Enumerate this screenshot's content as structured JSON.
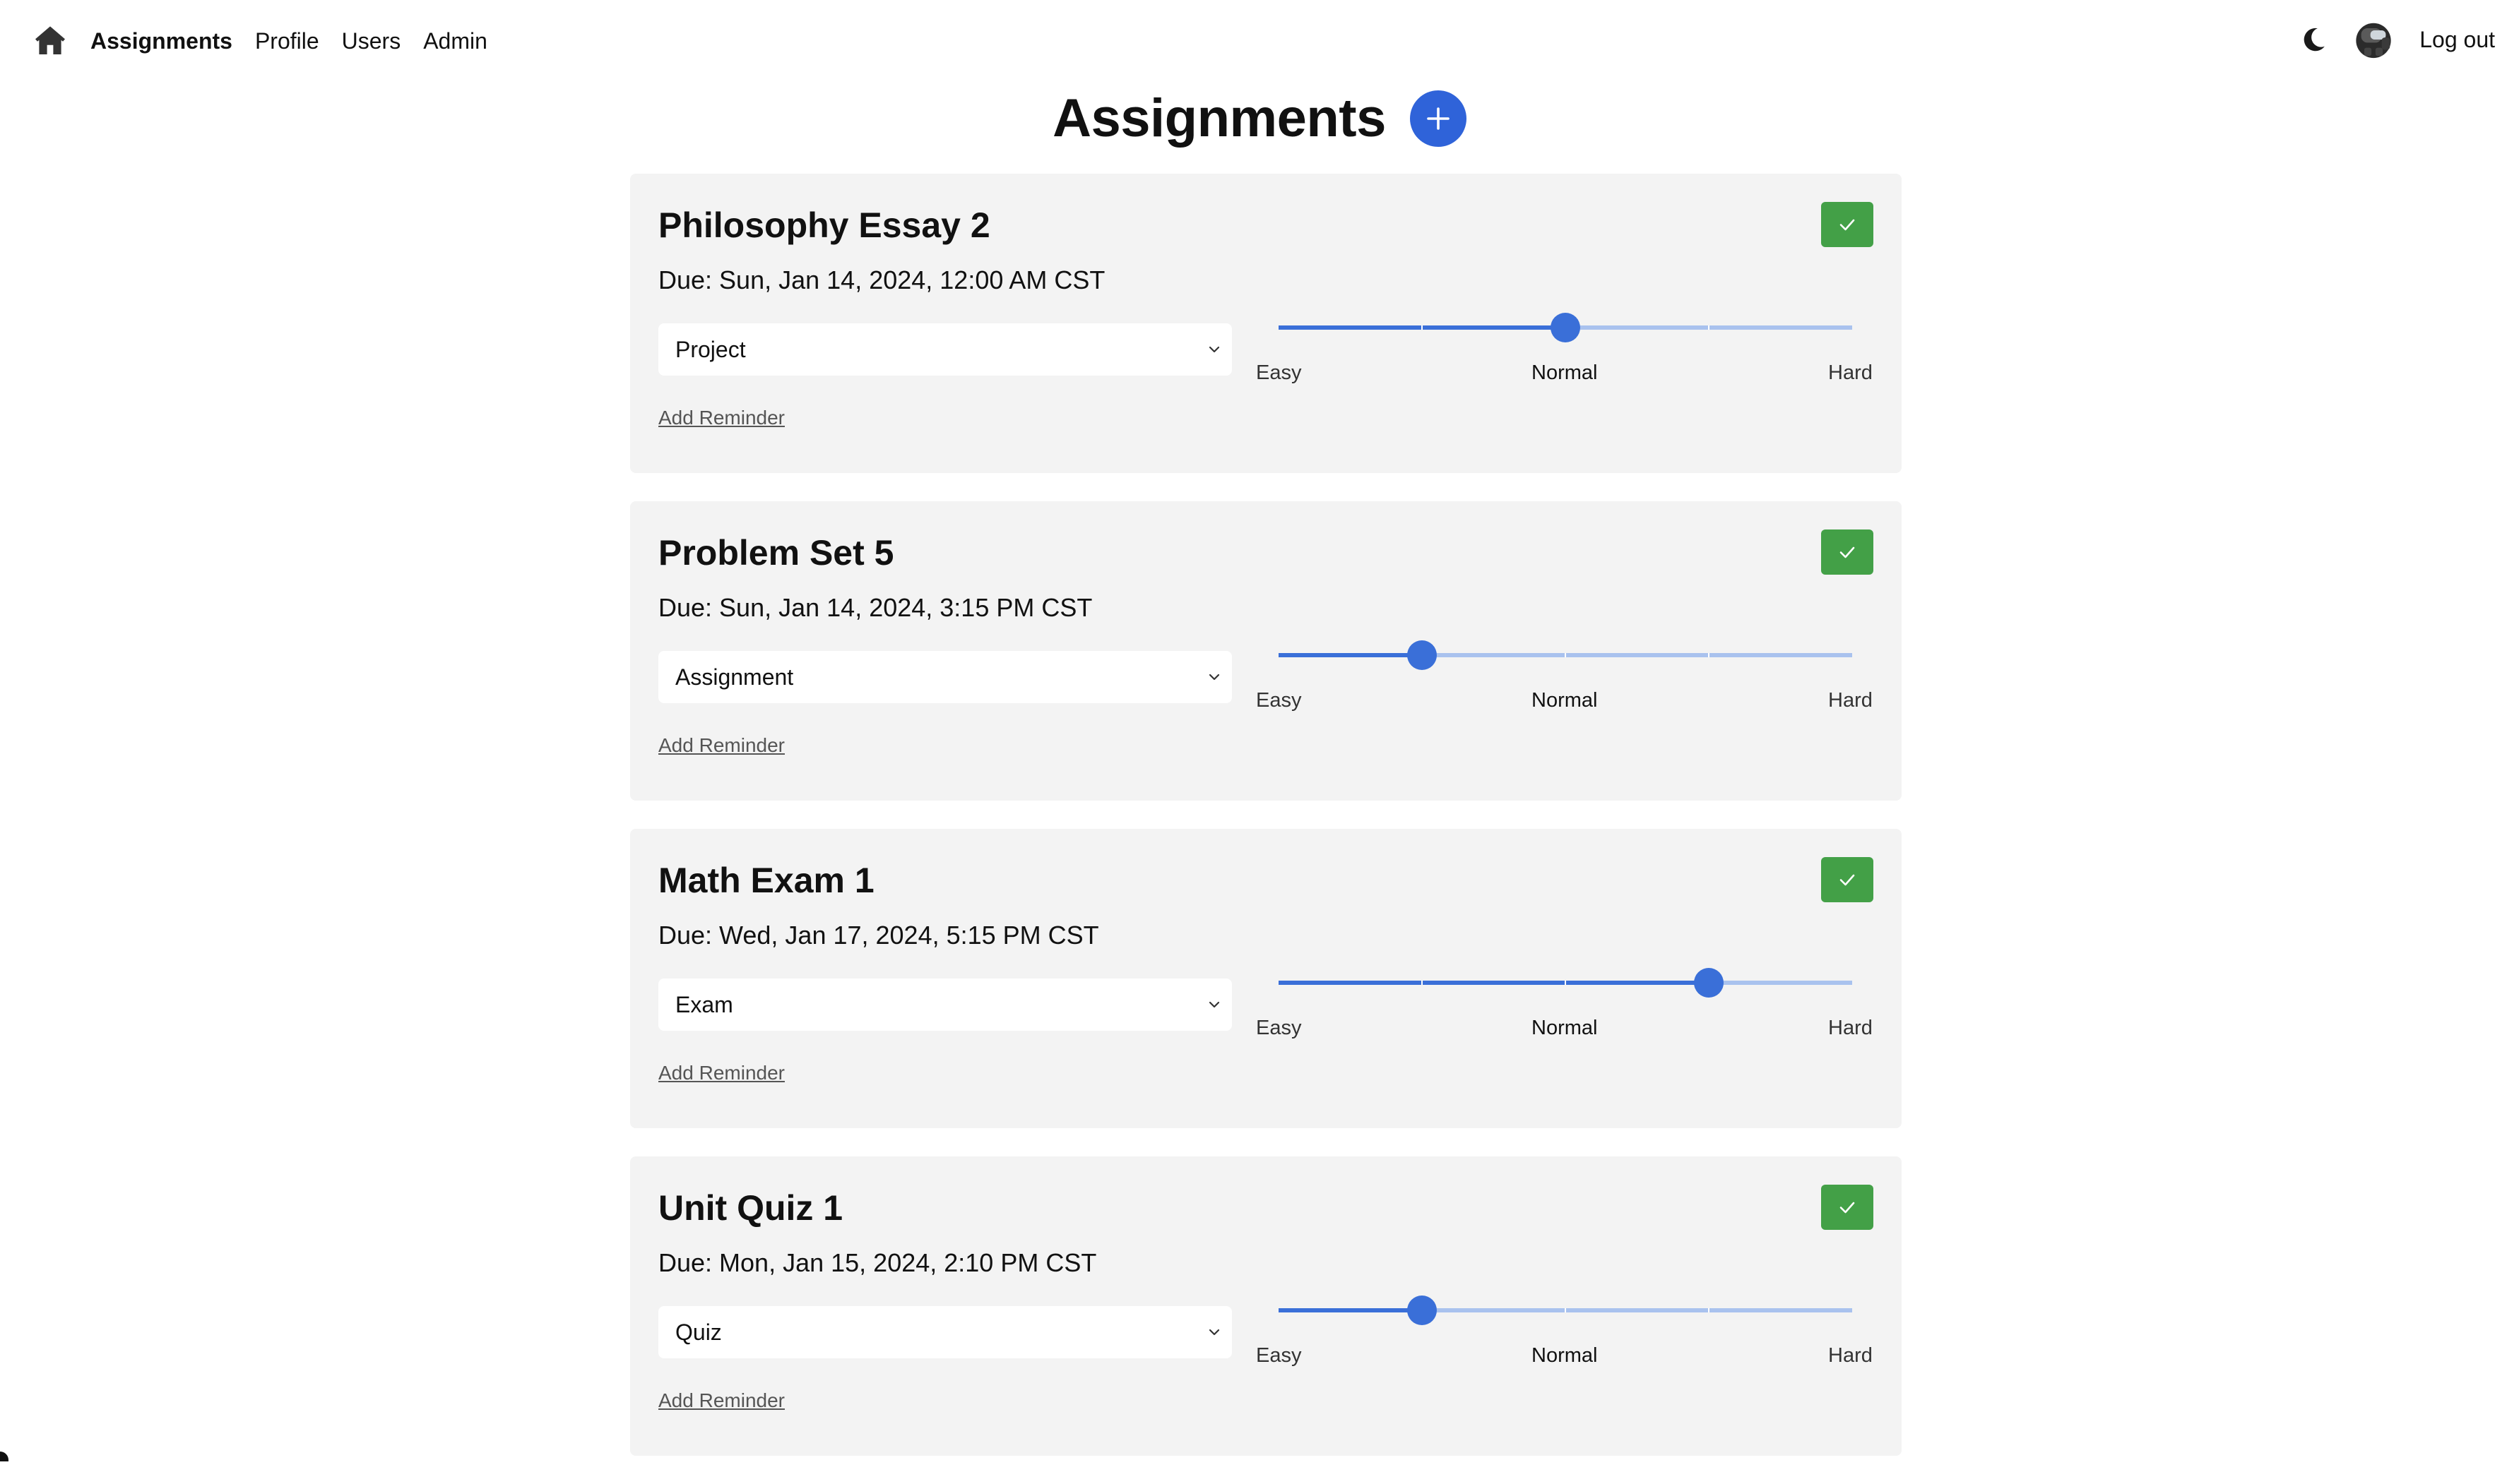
{
  "nav": {
    "home_icon": "home-icon",
    "links": [
      {
        "label": "Assignments",
        "active": true
      },
      {
        "label": "Profile",
        "active": false
      },
      {
        "label": "Users",
        "active": false
      },
      {
        "label": "Admin",
        "active": false
      }
    ],
    "theme_icon": "moon-icon",
    "avatar_icon": "avatar",
    "logout_label": "Log out"
  },
  "page": {
    "title": "Assignments",
    "add_icon": "plus-icon"
  },
  "colors": {
    "accent": "#2f63d9",
    "slider": "#3a6fd8",
    "complete": "#43a047",
    "card_bg": "#f3f3f3"
  },
  "difficulty_labels": {
    "easy": "Easy",
    "normal": "Normal",
    "hard": "Hard"
  },
  "assignments": [
    {
      "title": "Philosophy Essay 2",
      "due": "Due: Sun, Jan 14, 2024, 12:00 AM CST",
      "type": "Project",
      "difficulty": 0.5,
      "reminder_label": "Add Reminder"
    },
    {
      "title": "Problem Set 5",
      "due": "Due: Sun, Jan 14, 2024, 3:15 PM CST",
      "type": "Assignment",
      "difficulty": 0.25,
      "reminder_label": "Add Reminder"
    },
    {
      "title": "Math Exam 1",
      "due": "Due: Wed, Jan 17, 2024, 5:15 PM CST",
      "type": "Exam",
      "difficulty": 0.75,
      "reminder_label": "Add Reminder"
    },
    {
      "title": "Unit Quiz 1",
      "due": "Due: Mon, Jan 15, 2024, 2:10 PM CST",
      "type": "Quiz",
      "difficulty": 0.25,
      "reminder_label": "Add Reminder"
    }
  ]
}
